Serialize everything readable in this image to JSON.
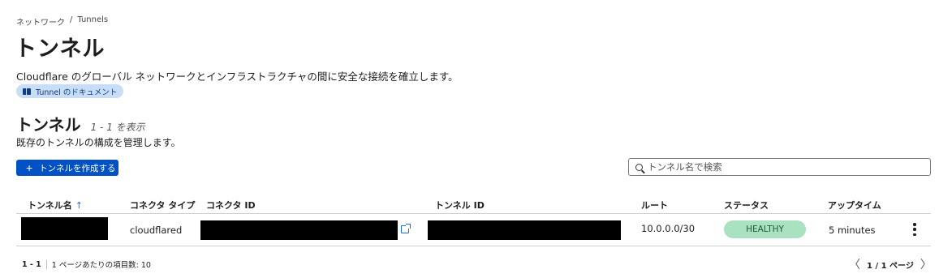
{
  "breadcrumb": {
    "parent": "ネットワーク",
    "separator": "/",
    "current": "Tunnels"
  },
  "page": {
    "title": "トンネル",
    "description": "Cloudflare のグローバル ネットワークとインフラストラクチャの間に安全な接続を確立します。",
    "doc_link": "Tunnel のドキュメント"
  },
  "section": {
    "title": "トンネル",
    "count": "1 - 1 を表示",
    "description": "既存のトンネルの構成を管理します。",
    "create_button": "トンネルを作成する",
    "create_icon": "+",
    "search_placeholder": "トンネル名で検索"
  },
  "table": {
    "columns": {
      "name": "トンネル名",
      "sort_arrow": "↑",
      "connector_type": "コネクタ タイプ",
      "connector_id": "コネクタ ID",
      "tunnel_id": "トンネル ID",
      "route": "ルート",
      "status": "ステータス",
      "uptime": "アップタイム"
    },
    "rows": [
      {
        "connector_type": "cloudflared",
        "route": "10.0.0.0/30",
        "status": "HEALTHY",
        "uptime": "5 minutes"
      }
    ]
  },
  "pagination": {
    "range": "1 - 1",
    "per_page": "1 ページあたりの項目数: 10",
    "page": "1 / 1 ページ",
    "prev": "〈",
    "next": "〉"
  },
  "colors": {
    "primary": "#0051c3",
    "status_healthy_bg": "#a9e1c1",
    "badge_bg": "#c9ddf6"
  }
}
